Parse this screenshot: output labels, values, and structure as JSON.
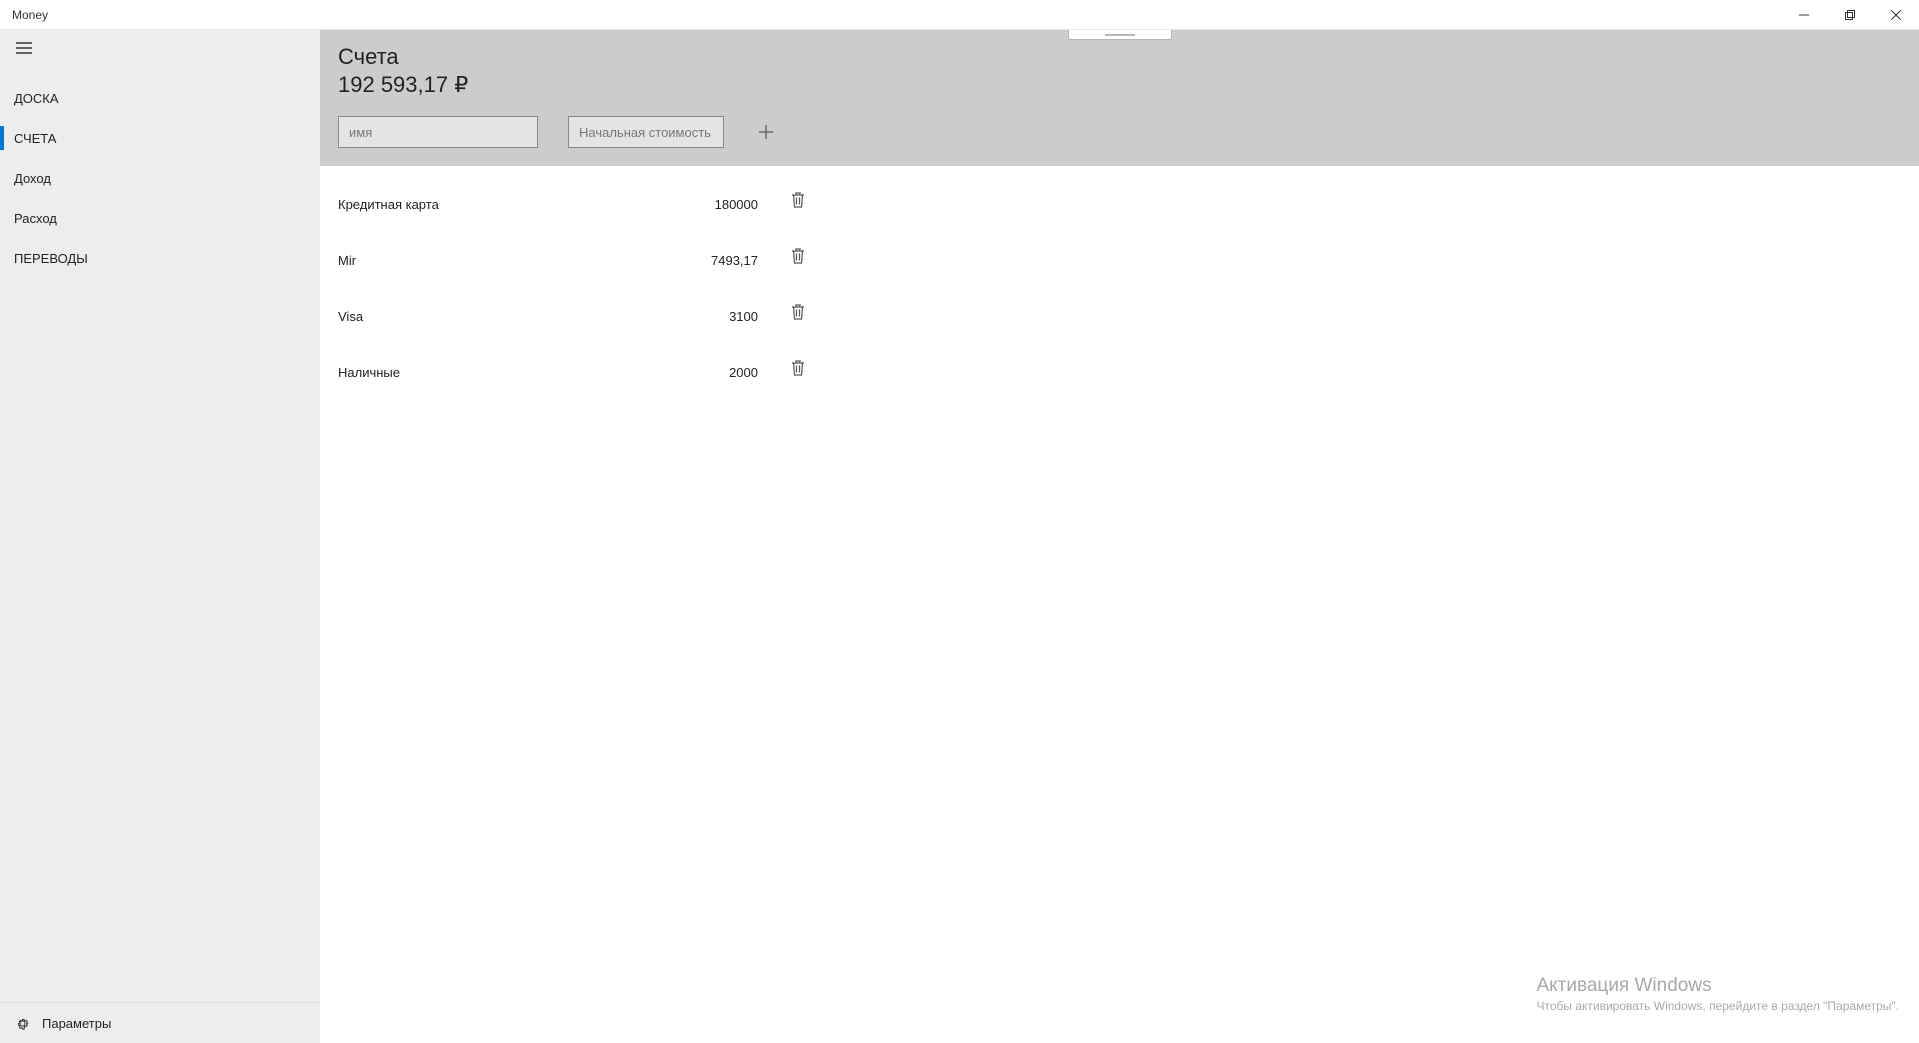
{
  "window": {
    "title": "Money"
  },
  "sidebar": {
    "items": [
      {
        "label": "ДОСКА"
      },
      {
        "label": "СЧЕТА"
      },
      {
        "label": "Доход"
      },
      {
        "label": "Расход"
      },
      {
        "label": "ПЕРЕВОДЫ"
      }
    ],
    "active_index": 1,
    "settings_label": "Параметры"
  },
  "header": {
    "title": "Счета",
    "total": "192 593,17 ₽",
    "name_placeholder": "имя",
    "cost_placeholder": "Начальная стоимость"
  },
  "accounts": [
    {
      "name": "Кредитная карта",
      "value": "180000"
    },
    {
      "name": "Mir",
      "value": "7493,17"
    },
    {
      "name": "Visa",
      "value": "3100"
    },
    {
      "name": "Наличные",
      "value": "2000"
    }
  ],
  "watermark": {
    "title": "Активация Windows",
    "subtitle": "Чтобы активировать Windows, перейдите в раздел \"Параметры\"."
  }
}
